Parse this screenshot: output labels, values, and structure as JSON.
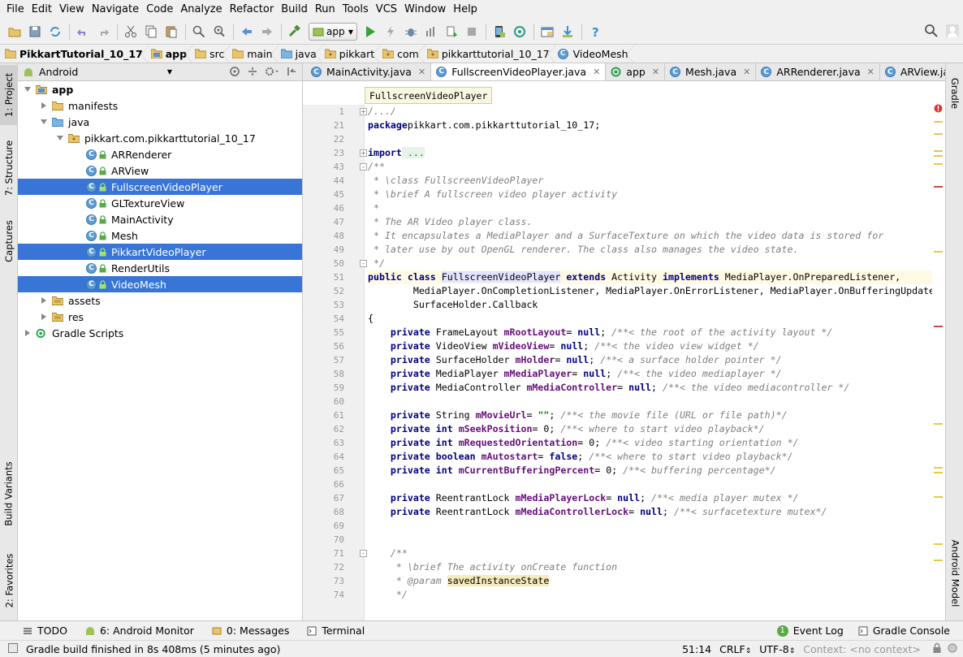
{
  "menu": [
    "File",
    "Edit",
    "View",
    "Navigate",
    "Code",
    "Analyze",
    "Refactor",
    "Build",
    "Run",
    "Tools",
    "VCS",
    "Window",
    "Help"
  ],
  "toolbar": {
    "run_config": "app"
  },
  "breadcrumbs": [
    "PikkartTutorial_10_17",
    "app",
    "src",
    "main",
    "java",
    "pikkart",
    "com",
    "pikkarttutorial_10_17",
    "VideoMesh"
  ],
  "left_strip": {
    "project": "1: Project",
    "structure": "7: Structure",
    "captures": "Captures",
    "build_variants": "Build Variants",
    "favorites": "2: Favorites"
  },
  "right_strip": {
    "gradle": "Gradle",
    "android_model": "Android Model"
  },
  "project_panel": {
    "view_selector": "Android",
    "tree": [
      {
        "label": "app",
        "level": 0,
        "type": "module",
        "expanded": true,
        "bold": true
      },
      {
        "label": "manifests",
        "level": 1,
        "type": "folder",
        "expanded": false
      },
      {
        "label": "java",
        "level": 1,
        "type": "folder",
        "expanded": true
      },
      {
        "label": "pikkart.com.pikkarttutorial_10_17",
        "level": 2,
        "type": "package",
        "expanded": true
      },
      {
        "label": "ARRenderer",
        "level": 3,
        "type": "class"
      },
      {
        "label": "ARView",
        "level": 3,
        "type": "class"
      },
      {
        "label": "FullscreenVideoPlayer",
        "level": 3,
        "type": "class",
        "selected": true
      },
      {
        "label": "GLTextureView",
        "level": 3,
        "type": "class"
      },
      {
        "label": "MainActivity",
        "level": 3,
        "type": "class"
      },
      {
        "label": "Mesh",
        "level": 3,
        "type": "class"
      },
      {
        "label": "PikkartVideoPlayer",
        "level": 3,
        "type": "class",
        "selected": true
      },
      {
        "label": "RenderUtils",
        "level": 3,
        "type": "class"
      },
      {
        "label": "VideoMesh",
        "level": 3,
        "type": "class",
        "selected": true
      },
      {
        "label": "assets",
        "level": 1,
        "type": "folder",
        "expanded": false
      },
      {
        "label": "res",
        "level": 1,
        "type": "folder",
        "expanded": false
      },
      {
        "label": "Gradle Scripts",
        "level": 0,
        "type": "gradle",
        "expanded": false
      }
    ]
  },
  "editor": {
    "tabs": [
      {
        "label": "MainActivity.java",
        "icon": "class"
      },
      {
        "label": "FullscreenVideoPlayer.java",
        "icon": "class",
        "active": true
      },
      {
        "label": "app",
        "icon": "gradle"
      },
      {
        "label": "Mesh.java",
        "icon": "class"
      },
      {
        "label": "ARRenderer.java",
        "icon": "class"
      },
      {
        "label": "ARView.java",
        "icon": "class"
      }
    ],
    "tab_overflow": "2",
    "tooltip": "FullscreenVideoPlayer",
    "line_numbers": [
      "1",
      "21",
      "22",
      "23",
      "43",
      "44",
      "45",
      "46",
      "47",
      "48",
      "49",
      "50",
      "51",
      "52",
      "53",
      "54",
      "55",
      "56",
      "57",
      "58",
      "59",
      "60",
      "61",
      "62",
      "63",
      "64",
      "65",
      "66",
      "67",
      "68",
      "69",
      "70",
      "71",
      "72",
      "73",
      "74"
    ],
    "code": [
      [
        [
          "cm",
          "/.../"
        ]
      ],
      [
        [
          "kw",
          "package"
        ],
        [
          "",
          "pikkart.com.pikkarttutorial_10_17;"
        ]
      ],
      [],
      [
        [
          "kw",
          "import"
        ],
        [
          "st",
          " ..."
        ]
      ],
      [
        [
          "cm",
          "/**"
        ]
      ],
      [
        [
          "cm",
          " * \\class FullscreenVideoPlayer"
        ]
      ],
      [
        [
          "cm",
          " * \\brief A fullscreen video player activity"
        ]
      ],
      [
        [
          "cm",
          " *"
        ]
      ],
      [
        [
          "cm",
          " * The AR Video player class."
        ]
      ],
      [
        [
          "cm",
          " * It encapsulates a MediaPlayer and a SurfaceTexture on which the video data is stored for"
        ]
      ],
      [
        [
          "cm",
          " * later use by out OpenGL renderer. The class also manages the video state."
        ]
      ],
      [
        [
          "cm",
          " */"
        ]
      ],
      [
        [
          "kw",
          "public class "
        ],
        [
          "hl",
          "FullscreenVideoPlayer"
        ],
        [
          "kw",
          " extends "
        ],
        [
          "",
          "Activity "
        ],
        [
          "kw",
          "implements "
        ],
        [
          "",
          "MediaPlayer.OnPreparedListener,"
        ]
      ],
      [
        [
          "",
          "        MediaPlayer.OnCompletionListener, MediaPlayer.OnErrorListener, MediaPlayer.OnBufferingUpdateListener,"
        ]
      ],
      [
        [
          "",
          "        SurfaceHolder.Callback"
        ]
      ],
      [
        [
          "",
          "{"
        ]
      ],
      [
        [
          "kw",
          "    private "
        ],
        [
          "",
          "FrameLayout "
        ],
        [
          "fd",
          "mRootLayout"
        ],
        [
          "",
          "",
          " "
        ],
        [
          "",
          "= "
        ],
        [
          "kw",
          "null"
        ],
        [
          "",
          "; "
        ],
        [
          "cm",
          "/**< the root of the activity layout */"
        ]
      ],
      [
        [
          "kw",
          "    private "
        ],
        [
          "",
          "VideoView "
        ],
        [
          "fd",
          "mVideoView"
        ],
        [
          "",
          "",
          " "
        ],
        [
          "",
          "= "
        ],
        [
          "kw",
          "null"
        ],
        [
          "",
          "; "
        ],
        [
          "cm",
          "/**< the video view widget */"
        ]
      ],
      [
        [
          "kw",
          "    private "
        ],
        [
          "",
          "SurfaceHolder "
        ],
        [
          "fd",
          "mHolder"
        ],
        [
          "",
          "",
          " "
        ],
        [
          "",
          "= "
        ],
        [
          "kw",
          "null"
        ],
        [
          "",
          "; "
        ],
        [
          "cm",
          "/**< a surface holder pointer */"
        ]
      ],
      [
        [
          "kw",
          "    private "
        ],
        [
          "",
          "MediaPlayer "
        ],
        [
          "fd",
          "mMediaPlayer"
        ],
        [
          "",
          "",
          " "
        ],
        [
          "",
          "= "
        ],
        [
          "kw",
          "null"
        ],
        [
          "",
          "; "
        ],
        [
          "cm",
          "/**< the video mediaplayer */"
        ]
      ],
      [
        [
          "kw",
          "    private "
        ],
        [
          "",
          "MediaController "
        ],
        [
          "fd",
          "mMediaController"
        ],
        [
          "",
          "",
          " "
        ],
        [
          "",
          "= "
        ],
        [
          "kw",
          "null"
        ],
        [
          "",
          "; "
        ],
        [
          "cm",
          "/**< the video mediacontroller */"
        ]
      ],
      [],
      [
        [
          "kw",
          "    private "
        ],
        [
          "",
          "String "
        ],
        [
          "fd",
          "mMovieUrl"
        ],
        [
          "",
          "",
          " "
        ],
        [
          "",
          "= "
        ],
        [
          "st",
          "\"\""
        ],
        [
          "",
          "; "
        ],
        [
          "cm",
          "/**< the movie file (URL or file path)*/"
        ]
      ],
      [
        [
          "kw",
          "    private int "
        ],
        [
          "fd",
          "mSeekPosition"
        ],
        [
          "",
          "",
          " "
        ],
        [
          "",
          "= "
        ],
        [
          "",
          "0"
        ],
        [
          "",
          "; "
        ],
        [
          "cm",
          "/**< where to start video playback*/"
        ]
      ],
      [
        [
          "kw",
          "    private int "
        ],
        [
          "fd",
          "mRequestedOrientation"
        ],
        [
          "",
          "",
          " "
        ],
        [
          "",
          "= "
        ],
        [
          "",
          "0"
        ],
        [
          "",
          "; "
        ],
        [
          "cm",
          "/**< video starting orientation */"
        ]
      ],
      [
        [
          "kw",
          "    private boolean "
        ],
        [
          "fd",
          "mAutostart"
        ],
        [
          "",
          "",
          " "
        ],
        [
          "",
          "= "
        ],
        [
          "kw",
          "false"
        ],
        [
          "",
          "; "
        ],
        [
          "cm",
          "/**< where to start video playback*/"
        ]
      ],
      [
        [
          "kw",
          "    private int "
        ],
        [
          "fd",
          "mCurrentBufferingPercent"
        ],
        [
          "",
          "",
          " "
        ],
        [
          "",
          "= "
        ],
        [
          "",
          "0"
        ],
        [
          "",
          "; "
        ],
        [
          "cm",
          "/**< buffering percentage*/"
        ]
      ],
      [],
      [
        [
          "kw",
          "    private "
        ],
        [
          "",
          "ReentrantLock "
        ],
        [
          "fd",
          "mMediaPlayerLock"
        ],
        [
          "",
          "",
          " "
        ],
        [
          "",
          "= "
        ],
        [
          "kw",
          "null"
        ],
        [
          "",
          "; "
        ],
        [
          "cm",
          "/**< media player mutex */"
        ]
      ],
      [
        [
          "kw",
          "    private "
        ],
        [
          "",
          "ReentrantLock "
        ],
        [
          "fd",
          "mMediaControllerLock"
        ],
        [
          "",
          "",
          " "
        ],
        [
          "",
          "= "
        ],
        [
          "kw",
          "null"
        ],
        [
          "",
          "; "
        ],
        [
          "cm",
          "/**< surfacetexture mutex*/"
        ]
      ],
      [],
      [],
      [
        [
          "cm",
          "    /**"
        ]
      ],
      [
        [
          "cm",
          "     * \\brief The activity onCreate function"
        ]
      ],
      [
        [
          "cm",
          "     * @param "
        ],
        [
          "pm",
          "savedInstanceState"
        ]
      ],
      [
        [
          "cm",
          "     */"
        ]
      ]
    ]
  },
  "bottom_tabs": [
    {
      "label": "TODO",
      "icon": "todo-icon"
    },
    {
      "label": "6: Android Monitor",
      "icon": "android-icon"
    },
    {
      "label": "0: Messages",
      "icon": "messages-icon"
    },
    {
      "label": "Terminal",
      "icon": "terminal-icon"
    },
    {
      "label": "Event Log",
      "icon": "event-log-icon",
      "badge": "1"
    },
    {
      "label": "Gradle Console",
      "icon": "gradle-console-icon"
    }
  ],
  "status": {
    "message": "Gradle build finished in 8s 408ms (5 minutes ago)",
    "position": "51:14",
    "line_sep": "CRLF",
    "encoding": "UTF-8",
    "context": "Context: <no context>"
  },
  "colors": {
    "selection": "#3875d7",
    "keyword": "#000080",
    "comment": "#808080",
    "field": "#660e7a",
    "string": "#008000"
  }
}
